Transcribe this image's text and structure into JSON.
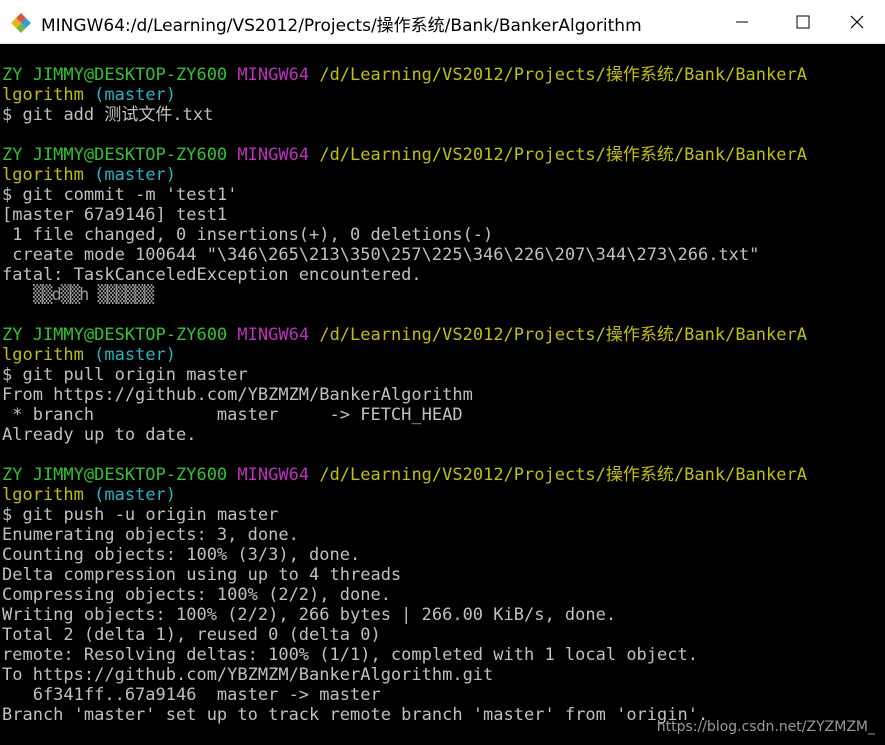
{
  "window": {
    "title": "MINGW64:/d/Learning/VS2012/Projects/操作系统/Bank/BankerAlgorithm",
    "controls": [
      "minimize",
      "maximize",
      "close"
    ]
  },
  "prompt": {
    "user_host": "ZY JIMMY@DESKTOP-ZY600",
    "env": "MINGW64",
    "path_line1": "/d/Learning/VS2012/Projects/操作系统/Bank/BankerA",
    "path_line2": "lgorithm",
    "branch": "(master)",
    "symbol": "$"
  },
  "blocks": [
    {
      "command": "git add 测试文件.txt",
      "output": []
    },
    {
      "command": "git commit -m 'test1'",
      "output": [
        "[master 67a9146] test1",
        " 1 file changed, 0 insertions(+), 0 deletions(-)",
        " create mode 100644 \"\\346\\265\\213\\350\\257\\225\\346\\226\\207\\344\\273\\266.txt\"",
        "fatal: TaskCanceledException encountered."
      ],
      "garbled": "▒▒d▒▒h ▒▒▒▒▒▒"
    },
    {
      "command": "git pull origin master",
      "output": [
        "From https://github.com/YBZMZM/BankerAlgorithm",
        " * branch            master     -> FETCH_HEAD",
        "Already up to date."
      ]
    },
    {
      "command": "git push -u origin master",
      "output": [
        "Enumerating objects: 3, done.",
        "Counting objects: 100% (3/3), done.",
        "Delta compression using up to 4 threads",
        "Compressing objects: 100% (2/2), done.",
        "Writing objects: 100% (2/2), 266 bytes | 266.00 KiB/s, done.",
        "Total 2 (delta 1), reused 0 (delta 0)",
        "remote: Resolving deltas: 100% (1/1), completed with 1 local object.",
        "To https://github.com/YBZMZM/BankerAlgorithm.git",
        "   6f341ff..67a9146  master -> master",
        "Branch 'master' set up to track remote branch 'master' from 'origin'."
      ]
    }
  ],
  "watermark": "https://blog.csdn.net/ZYZMZM_",
  "colors": {
    "background": "#000000",
    "user_host": "#2fc62f",
    "env": "#c02fc0",
    "path": "#c0c000",
    "branch": "#1fb8c0",
    "text": "#c0c0c0"
  },
  "icons": {
    "app": "git-bash-diamond-icon",
    "minimize": "minimize-icon",
    "maximize": "maximize-icon",
    "close": "close-icon"
  }
}
